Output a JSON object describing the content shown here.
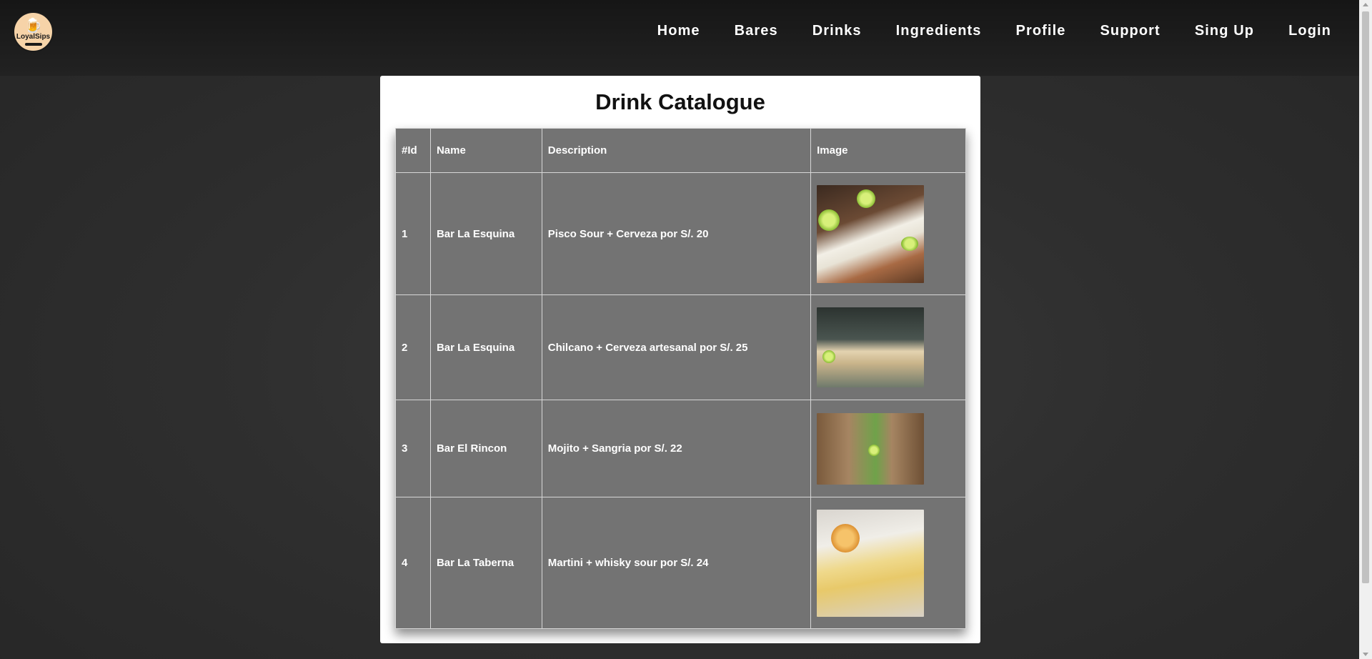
{
  "logo": {
    "text": "LoyalSips"
  },
  "nav": {
    "items": [
      "Home",
      "Bares",
      "Drinks",
      "Ingredients",
      "Profile",
      "Support",
      "Sing Up",
      "Login"
    ]
  },
  "page": {
    "title": "Drink Catalogue"
  },
  "table": {
    "headers": {
      "id": "#Id",
      "name": "Name",
      "description": "Description",
      "image": "Image"
    },
    "rows": [
      {
        "id": "1",
        "name": "Bar La Esquina",
        "description": "Pisco Sour + Cerveza por S/. 20"
      },
      {
        "id": "2",
        "name": "Bar La Esquina",
        "description": "Chilcano + Cerveza artesanal por S/. 25"
      },
      {
        "id": "3",
        "name": "Bar El Rincon",
        "description": "Mojito + Sangria por S/. 22"
      },
      {
        "id": "4",
        "name": "Bar La Taberna",
        "description": "Martini + whisky sour por S/. 24"
      }
    ]
  },
  "colors": {
    "navbar": "#1c1c1c",
    "background": "#2f2f2f",
    "table_bg": "#737373",
    "card_bg": "#ffffff"
  }
}
